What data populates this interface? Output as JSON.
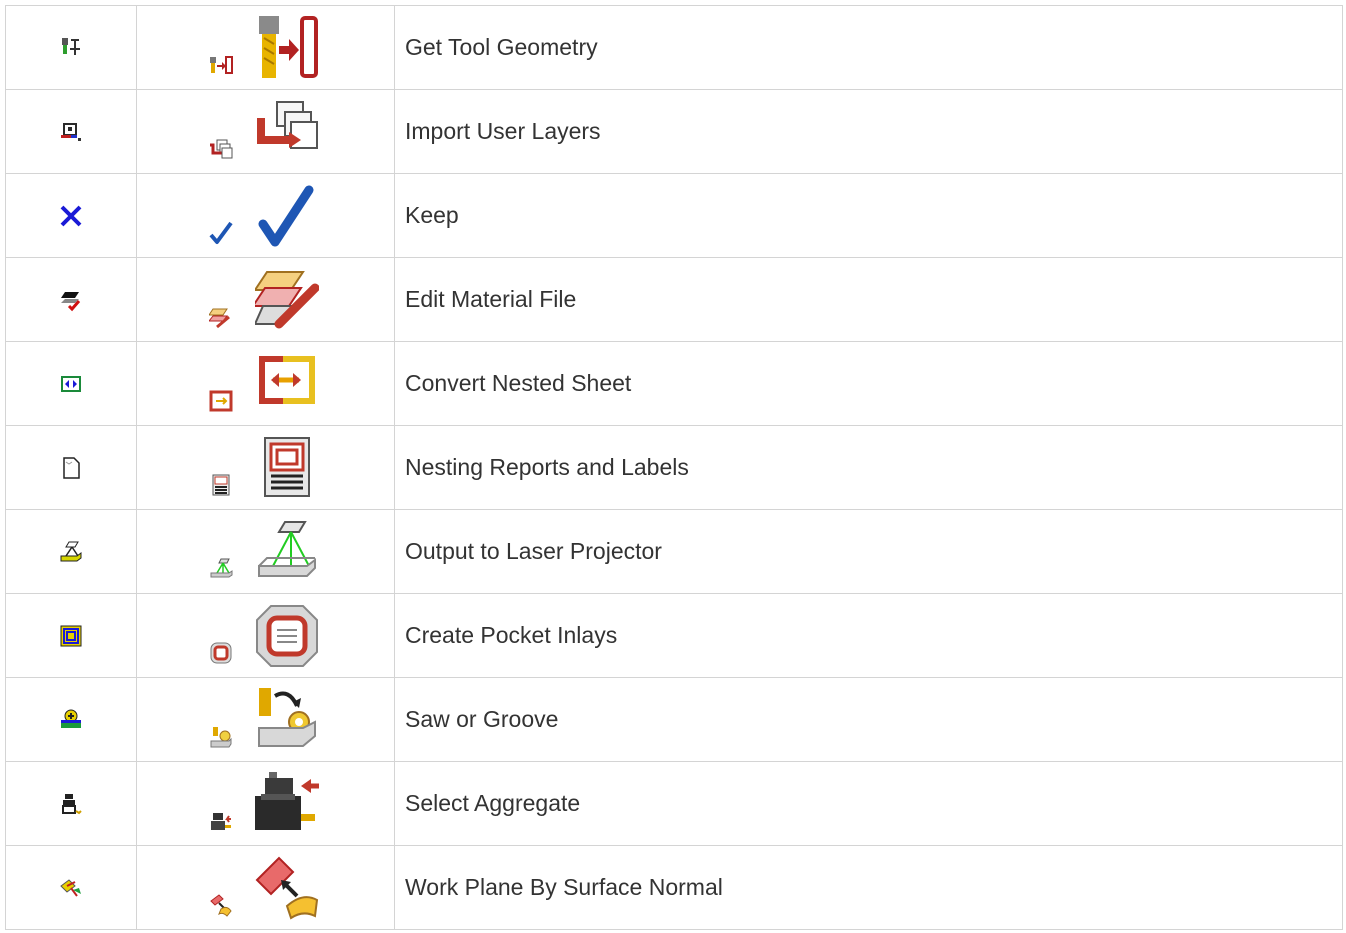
{
  "rows": [
    {
      "label": "Get Tool Geometry",
      "old_icon": "tool-geometry-legacy-icon",
      "small_icon": "tool-geometry-small-icon",
      "large_icon": "tool-geometry-large-icon"
    },
    {
      "label": "Import User Layers",
      "old_icon": "import-layers-legacy-icon",
      "small_icon": "import-layers-small-icon",
      "large_icon": "import-layers-large-icon"
    },
    {
      "label": "Keep",
      "old_icon": "blue-x-icon",
      "small_icon": "checkmark-small-icon",
      "large_icon": "checkmark-large-icon"
    },
    {
      "label": "Edit Material File",
      "old_icon": "material-legacy-icon",
      "small_icon": "material-small-icon",
      "large_icon": "material-large-icon"
    },
    {
      "label": "Convert Nested Sheet",
      "old_icon": "convert-sheet-legacy-icon",
      "small_icon": "convert-sheet-small-icon",
      "large_icon": "convert-sheet-large-icon"
    },
    {
      "label": "Nesting Reports and Labels",
      "old_icon": "blank-document-icon",
      "small_icon": "report-small-icon",
      "large_icon": "report-large-icon"
    },
    {
      "label": "Output to Laser Projector",
      "old_icon": "laser-legacy-icon",
      "small_icon": "laser-small-icon",
      "large_icon": "laser-large-icon"
    },
    {
      "label": "Create Pocket Inlays",
      "old_icon": "inlay-legacy-icon",
      "small_icon": "inlay-small-icon",
      "large_icon": "inlay-large-icon"
    },
    {
      "label": "Saw or Groove",
      "old_icon": "saw-legacy-icon",
      "small_icon": "saw-small-icon",
      "large_icon": "saw-large-icon"
    },
    {
      "label": "Select Aggregate",
      "old_icon": "aggregate-legacy-icon",
      "small_icon": "aggregate-small-icon",
      "large_icon": "aggregate-large-icon"
    },
    {
      "label": "Work Plane By Surface Normal",
      "old_icon": "work-plane-legacy-icon",
      "small_icon": "work-plane-small-icon",
      "large_icon": "work-plane-large-icon"
    }
  ]
}
